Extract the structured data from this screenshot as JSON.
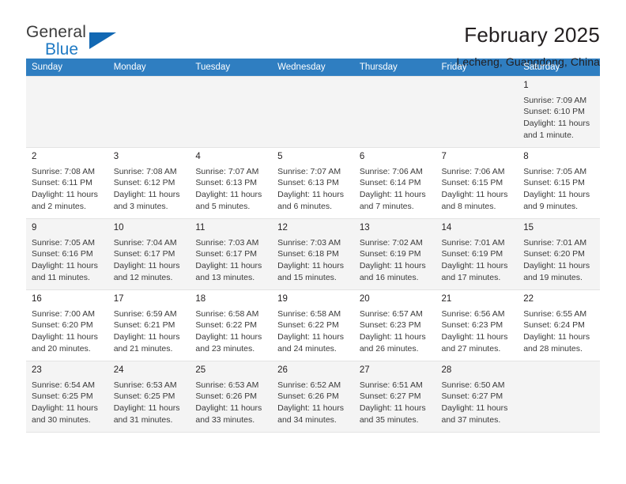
{
  "brand": {
    "name_part1": "General",
    "name_part2": "Blue",
    "triangle_icon": "triangle-icon",
    "accent_color": "#1268b3",
    "blue_text_color": "#1f7ac4"
  },
  "header": {
    "title": "February 2025",
    "location": "Lecheng, Guangdong, China"
  },
  "calendar": {
    "header_bg": "#2f7ec1",
    "weekdays": [
      "Sunday",
      "Monday",
      "Tuesday",
      "Wednesday",
      "Thursday",
      "Friday",
      "Saturday"
    ],
    "weeks": [
      [
        {
          "day": "",
          "sunrise": "",
          "sunset": "",
          "daylight": "",
          "daylight2": ""
        },
        {
          "day": "",
          "sunrise": "",
          "sunset": "",
          "daylight": "",
          "daylight2": ""
        },
        {
          "day": "",
          "sunrise": "",
          "sunset": "",
          "daylight": "",
          "daylight2": ""
        },
        {
          "day": "",
          "sunrise": "",
          "sunset": "",
          "daylight": "",
          "daylight2": ""
        },
        {
          "day": "",
          "sunrise": "",
          "sunset": "",
          "daylight": "",
          "daylight2": ""
        },
        {
          "day": "",
          "sunrise": "",
          "sunset": "",
          "daylight": "",
          "daylight2": ""
        },
        {
          "day": "1",
          "sunrise": "Sunrise: 7:09 AM",
          "sunset": "Sunset: 6:10 PM",
          "daylight": "Daylight: 11 hours",
          "daylight2": "and 1 minute."
        }
      ],
      [
        {
          "day": "2",
          "sunrise": "Sunrise: 7:08 AM",
          "sunset": "Sunset: 6:11 PM",
          "daylight": "Daylight: 11 hours",
          "daylight2": "and 2 minutes."
        },
        {
          "day": "3",
          "sunrise": "Sunrise: 7:08 AM",
          "sunset": "Sunset: 6:12 PM",
          "daylight": "Daylight: 11 hours",
          "daylight2": "and 3 minutes."
        },
        {
          "day": "4",
          "sunrise": "Sunrise: 7:07 AM",
          "sunset": "Sunset: 6:13 PM",
          "daylight": "Daylight: 11 hours",
          "daylight2": "and 5 minutes."
        },
        {
          "day": "5",
          "sunrise": "Sunrise: 7:07 AM",
          "sunset": "Sunset: 6:13 PM",
          "daylight": "Daylight: 11 hours",
          "daylight2": "and 6 minutes."
        },
        {
          "day": "6",
          "sunrise": "Sunrise: 7:06 AM",
          "sunset": "Sunset: 6:14 PM",
          "daylight": "Daylight: 11 hours",
          "daylight2": "and 7 minutes."
        },
        {
          "day": "7",
          "sunrise": "Sunrise: 7:06 AM",
          "sunset": "Sunset: 6:15 PM",
          "daylight": "Daylight: 11 hours",
          "daylight2": "and 8 minutes."
        },
        {
          "day": "8",
          "sunrise": "Sunrise: 7:05 AM",
          "sunset": "Sunset: 6:15 PM",
          "daylight": "Daylight: 11 hours",
          "daylight2": "and 9 minutes."
        }
      ],
      [
        {
          "day": "9",
          "sunrise": "Sunrise: 7:05 AM",
          "sunset": "Sunset: 6:16 PM",
          "daylight": "Daylight: 11 hours",
          "daylight2": "and 11 minutes."
        },
        {
          "day": "10",
          "sunrise": "Sunrise: 7:04 AM",
          "sunset": "Sunset: 6:17 PM",
          "daylight": "Daylight: 11 hours",
          "daylight2": "and 12 minutes."
        },
        {
          "day": "11",
          "sunrise": "Sunrise: 7:03 AM",
          "sunset": "Sunset: 6:17 PM",
          "daylight": "Daylight: 11 hours",
          "daylight2": "and 13 minutes."
        },
        {
          "day": "12",
          "sunrise": "Sunrise: 7:03 AM",
          "sunset": "Sunset: 6:18 PM",
          "daylight": "Daylight: 11 hours",
          "daylight2": "and 15 minutes."
        },
        {
          "day": "13",
          "sunrise": "Sunrise: 7:02 AM",
          "sunset": "Sunset: 6:19 PM",
          "daylight": "Daylight: 11 hours",
          "daylight2": "and 16 minutes."
        },
        {
          "day": "14",
          "sunrise": "Sunrise: 7:01 AM",
          "sunset": "Sunset: 6:19 PM",
          "daylight": "Daylight: 11 hours",
          "daylight2": "and 17 minutes."
        },
        {
          "day": "15",
          "sunrise": "Sunrise: 7:01 AM",
          "sunset": "Sunset: 6:20 PM",
          "daylight": "Daylight: 11 hours",
          "daylight2": "and 19 minutes."
        }
      ],
      [
        {
          "day": "16",
          "sunrise": "Sunrise: 7:00 AM",
          "sunset": "Sunset: 6:20 PM",
          "daylight": "Daylight: 11 hours",
          "daylight2": "and 20 minutes."
        },
        {
          "day": "17",
          "sunrise": "Sunrise: 6:59 AM",
          "sunset": "Sunset: 6:21 PM",
          "daylight": "Daylight: 11 hours",
          "daylight2": "and 21 minutes."
        },
        {
          "day": "18",
          "sunrise": "Sunrise: 6:58 AM",
          "sunset": "Sunset: 6:22 PM",
          "daylight": "Daylight: 11 hours",
          "daylight2": "and 23 minutes."
        },
        {
          "day": "19",
          "sunrise": "Sunrise: 6:58 AM",
          "sunset": "Sunset: 6:22 PM",
          "daylight": "Daylight: 11 hours",
          "daylight2": "and 24 minutes."
        },
        {
          "day": "20",
          "sunrise": "Sunrise: 6:57 AM",
          "sunset": "Sunset: 6:23 PM",
          "daylight": "Daylight: 11 hours",
          "daylight2": "and 26 minutes."
        },
        {
          "day": "21",
          "sunrise": "Sunrise: 6:56 AM",
          "sunset": "Sunset: 6:23 PM",
          "daylight": "Daylight: 11 hours",
          "daylight2": "and 27 minutes."
        },
        {
          "day": "22",
          "sunrise": "Sunrise: 6:55 AM",
          "sunset": "Sunset: 6:24 PM",
          "daylight": "Daylight: 11 hours",
          "daylight2": "and 28 minutes."
        }
      ],
      [
        {
          "day": "23",
          "sunrise": "Sunrise: 6:54 AM",
          "sunset": "Sunset: 6:25 PM",
          "daylight": "Daylight: 11 hours",
          "daylight2": "and 30 minutes."
        },
        {
          "day": "24",
          "sunrise": "Sunrise: 6:53 AM",
          "sunset": "Sunset: 6:25 PM",
          "daylight": "Daylight: 11 hours",
          "daylight2": "and 31 minutes."
        },
        {
          "day": "25",
          "sunrise": "Sunrise: 6:53 AM",
          "sunset": "Sunset: 6:26 PM",
          "daylight": "Daylight: 11 hours",
          "daylight2": "and 33 minutes."
        },
        {
          "day": "26",
          "sunrise": "Sunrise: 6:52 AM",
          "sunset": "Sunset: 6:26 PM",
          "daylight": "Daylight: 11 hours",
          "daylight2": "and 34 minutes."
        },
        {
          "day": "27",
          "sunrise": "Sunrise: 6:51 AM",
          "sunset": "Sunset: 6:27 PM",
          "daylight": "Daylight: 11 hours",
          "daylight2": "and 35 minutes."
        },
        {
          "day": "28",
          "sunrise": "Sunrise: 6:50 AM",
          "sunset": "Sunset: 6:27 PM",
          "daylight": "Daylight: 11 hours",
          "daylight2": "and 37 minutes."
        },
        {
          "day": "",
          "sunrise": "",
          "sunset": "",
          "daylight": "",
          "daylight2": ""
        }
      ]
    ]
  }
}
